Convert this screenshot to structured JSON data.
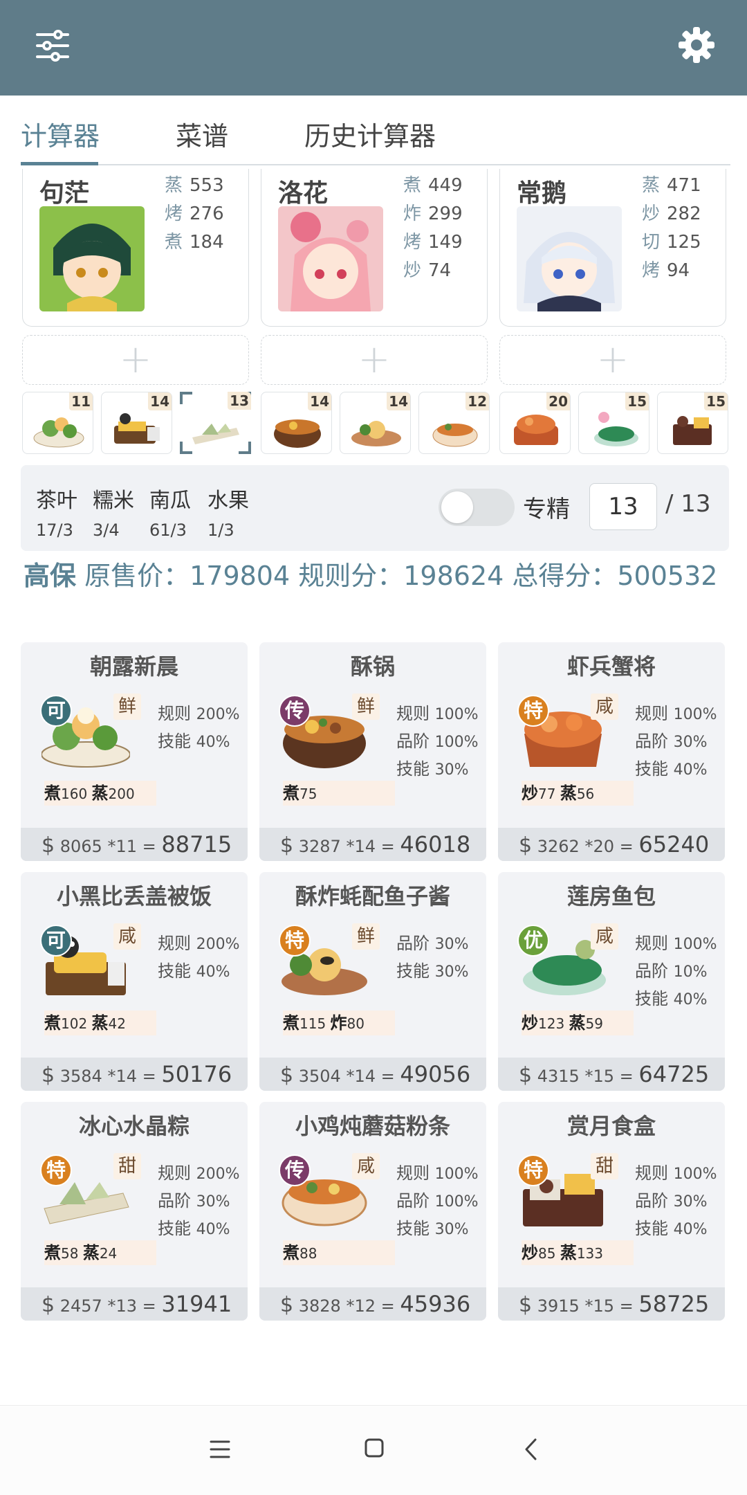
{
  "tabs": [
    {
      "label": "计算器",
      "active": true
    },
    {
      "label": "菜谱",
      "active": false
    },
    {
      "label": "历史计算器",
      "active": false
    }
  ],
  "chefs": [
    {
      "name": "句茫",
      "skills": [
        {
          "k": "蒸",
          "v": "553"
        },
        {
          "k": "烤",
          "v": "276"
        },
        {
          "k": "煮",
          "v": "184"
        }
      ]
    },
    {
      "name": "洛花",
      "skills": [
        {
          "k": "煮",
          "v": "449"
        },
        {
          "k": "炸",
          "v": "299"
        },
        {
          "k": "烤",
          "v": "149"
        },
        {
          "k": "炒",
          "v": "74"
        }
      ]
    },
    {
      "name": "常鹅",
      "skills": [
        {
          "k": "蒸",
          "v": "471"
        },
        {
          "k": "炒",
          "v": "282"
        },
        {
          "k": "切",
          "v": "125"
        },
        {
          "k": "烤",
          "v": "94"
        }
      ]
    }
  ],
  "add_slot_label": "+",
  "dish_slots": [
    "11",
    "14",
    "13",
    "14",
    "14",
    "12",
    "20",
    "15",
    "15"
  ],
  "ingredients": [
    {
      "name": "茶叶",
      "value": "17/3"
    },
    {
      "name": "糯米",
      "value": "3/4"
    },
    {
      "name": "南瓜",
      "value": "61/3"
    },
    {
      "name": "水果",
      "value": "1/3"
    }
  ],
  "specialize": {
    "label": "专精",
    "value": "13",
    "total": "/ 13",
    "enabled": false
  },
  "summary": {
    "strong": "高保",
    "text": " 原售价：179804 规则分：198624 总得分：500532"
  },
  "recipes": [
    {
      "title": "朝露新晨",
      "rarity": "可",
      "rarity_color": "#3b6f78",
      "flavor": "鲜",
      "stats": [
        {
          "k": "规则",
          "v": "200%"
        },
        {
          "k": "技能",
          "v": "40%"
        }
      ],
      "req": [
        {
          "k": "煮",
          "v": "160"
        },
        {
          "k": "蒸",
          "v": "200"
        }
      ],
      "price": "8065",
      "mult": "*11",
      "total": "88715"
    },
    {
      "title": "酥锅",
      "rarity": "传",
      "rarity_color": "#7b3b68",
      "flavor": "鲜",
      "stats": [
        {
          "k": "规则",
          "v": "100%"
        },
        {
          "k": "品阶",
          "v": "100%"
        },
        {
          "k": "技能",
          "v": "30%"
        }
      ],
      "req": [
        {
          "k": "煮",
          "v": "75"
        }
      ],
      "price": "3287",
      "mult": "*14",
      "total": "46018"
    },
    {
      "title": "虾兵蟹将",
      "rarity": "特",
      "rarity_color": "#d9801f",
      "flavor": "咸",
      "stats": [
        {
          "k": "规则",
          "v": "100%"
        },
        {
          "k": "品阶",
          "v": "30%"
        },
        {
          "k": "技能",
          "v": "40%"
        }
      ],
      "req": [
        {
          "k": "炒",
          "v": "77"
        },
        {
          "k": "蒸",
          "v": "56"
        }
      ],
      "price": "3262",
      "mult": "*20",
      "total": "65240"
    },
    {
      "title": "小黑比丢盖被饭",
      "rarity": "可",
      "rarity_color": "#3b6f78",
      "flavor": "咸",
      "stats": [
        {
          "k": "规则",
          "v": "200%"
        },
        {
          "k": "技能",
          "v": "40%"
        }
      ],
      "req": [
        {
          "k": "煮",
          "v": "102"
        },
        {
          "k": "蒸",
          "v": "42"
        }
      ],
      "price": "3584",
      "mult": "*14",
      "total": "50176"
    },
    {
      "title": "酥炸蚝配鱼子酱",
      "rarity": "特",
      "rarity_color": "#d9801f",
      "flavor": "鲜",
      "stats": [
        {
          "k": "品阶",
          "v": "30%"
        },
        {
          "k": "技能",
          "v": "30%"
        }
      ],
      "req": [
        {
          "k": "煮",
          "v": "115"
        },
        {
          "k": "炸",
          "v": "80"
        }
      ],
      "price": "3504",
      "mult": "*14",
      "total": "49056"
    },
    {
      "title": "莲房鱼包",
      "rarity": "优",
      "rarity_color": "#6aa03a",
      "flavor": "咸",
      "stats": [
        {
          "k": "规则",
          "v": "100%"
        },
        {
          "k": "品阶",
          "v": "10%"
        },
        {
          "k": "技能",
          "v": "40%"
        }
      ],
      "req": [
        {
          "k": "炒",
          "v": "123"
        },
        {
          "k": "蒸",
          "v": "59"
        }
      ],
      "price": "4315",
      "mult": "*15",
      "total": "64725"
    },
    {
      "title": "冰心水晶粽",
      "rarity": "特",
      "rarity_color": "#d9801f",
      "flavor": "甜",
      "stats": [
        {
          "k": "规则",
          "v": "200%"
        },
        {
          "k": "品阶",
          "v": "30%"
        },
        {
          "k": "技能",
          "v": "40%"
        }
      ],
      "req": [
        {
          "k": "煮",
          "v": "58"
        },
        {
          "k": "蒸",
          "v": "24"
        }
      ],
      "price": "2457",
      "mult": "*13",
      "total": "31941"
    },
    {
      "title": "小鸡炖蘑菇粉条",
      "rarity": "传",
      "rarity_color": "#7b3b68",
      "flavor": "咸",
      "stats": [
        {
          "k": "规则",
          "v": "100%"
        },
        {
          "k": "品阶",
          "v": "100%"
        },
        {
          "k": "技能",
          "v": "30%"
        }
      ],
      "req": [
        {
          "k": "煮",
          "v": "88"
        }
      ],
      "price": "3828",
      "mult": "*12",
      "total": "45936"
    },
    {
      "title": "赏月食盒",
      "rarity": "特",
      "rarity_color": "#d9801f",
      "flavor": "甜",
      "stats": [
        {
          "k": "规则",
          "v": "100%"
        },
        {
          "k": "品阶",
          "v": "30%"
        },
        {
          "k": "技能",
          "v": "40%"
        }
      ],
      "req": [
        {
          "k": "炒",
          "v": "85"
        },
        {
          "k": "蒸",
          "v": "133"
        }
      ],
      "price": "3915",
      "mult": "*15",
      "total": "58725"
    }
  ],
  "currency": "$",
  "equals": "=",
  "icons": {
    "menu": "sliders-icon",
    "settings": "gear-icon",
    "nav_recent": "menu-lines-icon",
    "nav_home": "square-home-icon",
    "nav_back": "chevron-left-icon"
  },
  "colors": {
    "appbar": "#5f7c89",
    "accent": "#5a8294"
  }
}
